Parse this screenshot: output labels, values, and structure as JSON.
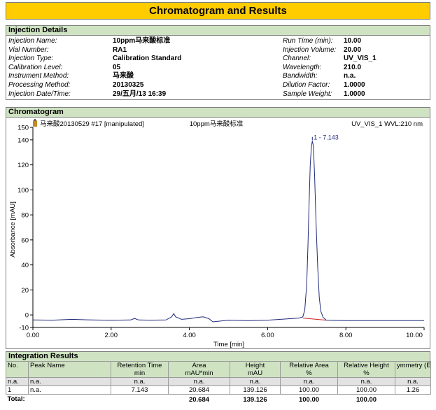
{
  "title": "Chromatogram and Results",
  "injection_details": {
    "section_title": "Injection Details",
    "left": [
      {
        "label": "Injection Name:",
        "value": "10ppm马来酸标准"
      },
      {
        "label": "Vial Number:",
        "value": "RA1"
      },
      {
        "label": "Injection Type:",
        "value": "Calibration Standard"
      },
      {
        "label": "Calibration Level:",
        "value": "05"
      },
      {
        "label": "Instrument Method:",
        "value": "马来酸"
      },
      {
        "label": "Processing Method:",
        "value": "20130325"
      },
      {
        "label": "Injection Date/Time:",
        "value": "29/五月/13 16:39"
      }
    ],
    "right": [
      {
        "label": "Run Time (min):",
        "value": "10.00"
      },
      {
        "label": "Injection Volume:",
        "value": "20.00"
      },
      {
        "label": "Channel:",
        "value": "UV_VIS_1"
      },
      {
        "label": "Wavelength:",
        "value": "210.0"
      },
      {
        "label": "Bandwidth:",
        "value": "n.a."
      },
      {
        "label": "Dilution Factor:",
        "value": "1.0000"
      },
      {
        "label": "Sample Weight:",
        "value": "1.0000"
      }
    ]
  },
  "chromatogram": {
    "section_title": "Chromatogram",
    "header_left": "马来酸20130529 #17 [manipulated]",
    "header_center": "10ppm马来酸标准",
    "header_right": "UV_VIS_1 WVL:210 nm"
  },
  "chart_data": {
    "type": "line",
    "xlabel": "Time [min]",
    "ylabel": "Absorbance [mAU]",
    "xlim": [
      0,
      10
    ],
    "ylim": [
      -10,
      150
    ],
    "x_ticks": [
      "0.00",
      "2.00",
      "4.00",
      "6.00",
      "8.00",
      "10.00"
    ],
    "y_ticks": [
      "-10",
      "0",
      "20",
      "40",
      "60",
      "80",
      "100",
      "120",
      "140",
      "150"
    ],
    "peak_label": "1 - 7.143",
    "series": [
      {
        "x": [
          0,
          0.5,
          1.0,
          1.5,
          2.0,
          2.5,
          2.6,
          2.7,
          3.0,
          3.4,
          3.55,
          3.6,
          3.65,
          3.8,
          4.0,
          4.2,
          4.35,
          4.5,
          4.6,
          4.75,
          5.0,
          5.5,
          6.0,
          6.5,
          6.8,
          6.9,
          6.95,
          7.0,
          7.03,
          7.06,
          7.09,
          7.12,
          7.143,
          7.17,
          7.2,
          7.24,
          7.28,
          7.32,
          7.36,
          7.42,
          7.5,
          8.0,
          9.0,
          10.0
        ],
        "y": [
          -4,
          -4.2,
          -3.5,
          -4,
          -4.3,
          -4,
          -2.8,
          -4,
          -4.2,
          -4,
          -1.5,
          1,
          -1.5,
          -3.5,
          -3,
          -2,
          -1.5,
          -3,
          -5.5,
          -5,
          -4.2,
          -4.5,
          -4.2,
          -3.2,
          -2.5,
          -1.5,
          4,
          25,
          55,
          90,
          120,
          135,
          139,
          135,
          112,
          72,
          38,
          14,
          3,
          -2,
          -4.2,
          -4.5,
          -4.5,
          -4.5
        ]
      }
    ]
  },
  "integration_results": {
    "section_title": "Integration Results",
    "columns": [
      {
        "name": "No.",
        "unit": ""
      },
      {
        "name": "Peak Name",
        "unit": ""
      },
      {
        "name": "Retention Time",
        "unit": "min"
      },
      {
        "name": "Area",
        "unit": "mAU*min"
      },
      {
        "name": "Height",
        "unit": "mAU"
      },
      {
        "name": "Relative Area",
        "unit": "%"
      },
      {
        "name": "Relative Height",
        "unit": "%"
      },
      {
        "name": "ymmetry (E",
        "unit": ""
      }
    ],
    "rows": [
      [
        "n.a.",
        "n.a.",
        "n.a.",
        "n.a.",
        "n.a.",
        "n.a.",
        "n.a.",
        "n.a."
      ],
      [
        "1",
        "n.a.",
        "7.143",
        "20.684",
        "139.126",
        "100.00",
        "100.00",
        "1.26"
      ]
    ],
    "total_label": "Total:",
    "totals": [
      "20.684",
      "139.126",
      "100.00",
      "100.00"
    ]
  },
  "colors": {
    "banner": "#ffcc00",
    "section": "#cfe3c2",
    "trace": "#1f2a7a"
  }
}
